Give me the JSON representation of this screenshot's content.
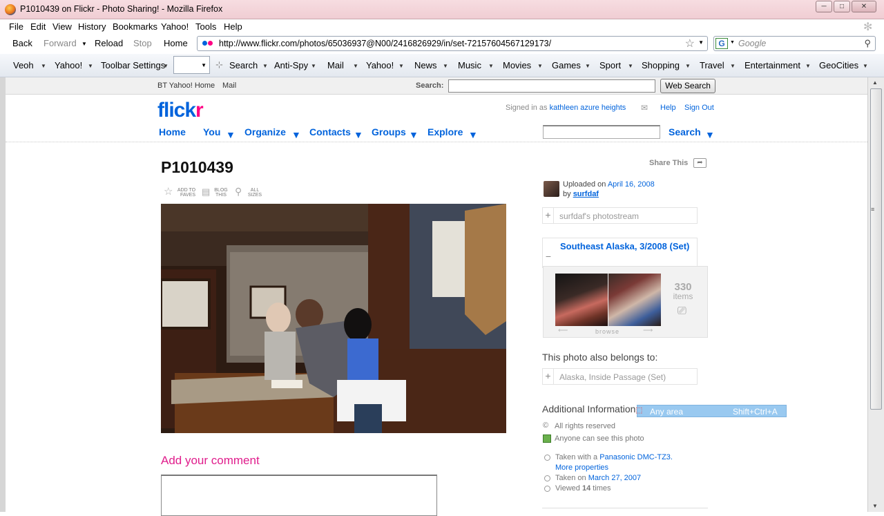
{
  "window": {
    "title": "P1010439 on Flickr - Photo Sharing! - Mozilla Firefox",
    "min": "─",
    "max": "□",
    "close": "✕"
  },
  "menu": [
    "File",
    "Edit",
    "View",
    "History",
    "Bookmarks",
    "Yahoo!",
    "Tools",
    "Help"
  ],
  "nav": {
    "back": "Back",
    "forward": "Forward",
    "reload": "Reload",
    "stop": "Stop",
    "home": "Home",
    "url": "http://www.flickr.com/photos/65036937@N00/2416826929/in/set-72157604567129173/",
    "search_placeholder": "Google"
  },
  "yahoo_toolbar": [
    "Veoh",
    "Yahoo!",
    "Toolbar Settings",
    "Search",
    "Anti-Spy",
    "Mail",
    "Yahoo!",
    "News",
    "Music",
    "Movies",
    "Games",
    "Sport",
    "Shopping",
    "Travel",
    "Entertainment",
    "GeoCities"
  ],
  "bt_bar": {
    "home": "BT Yahoo! Home",
    "mail": "Mail",
    "search_label": "Search:",
    "button": "Web Search"
  },
  "flickr": {
    "logo_a": "flick",
    "logo_b": "r",
    "signed_in_prefix": "Signed in as",
    "user": "kathleen azure heights",
    "help": "Help",
    "signout": "Sign Out",
    "nav": [
      "Home",
      "You",
      "Organize",
      "Contacts",
      "Groups",
      "Explore"
    ],
    "search_button": "Search"
  },
  "photo": {
    "title": "P1010439",
    "share": "Share This",
    "tools": [
      [
        "ADD TO",
        "FAVES"
      ],
      [
        "BLOG",
        "THIS"
      ],
      [
        "ALL",
        "SIZES"
      ]
    ],
    "add_comment": "Add your comment"
  },
  "sidebar": {
    "uploaded_prefix": "Uploaded on",
    "uploaded_date": "April 16, 2008",
    "by_prefix": "by",
    "owner": "surfdaf",
    "photostream": "surfdaf's photostream",
    "set_title": "Southeast Alaska, 3/2008 (Set)",
    "set_count": "330",
    "set_items": "items",
    "browse": "browse",
    "belongs": "This photo also belongs to:",
    "other_set": "Alaska, Inside Passage (Set)",
    "additional": "Additional Information",
    "tooltip_left": "Any area",
    "tooltip_right": "Shift+Ctrl+A",
    "rights": "All rights reserved",
    "visibility": "Anyone can see this photo",
    "taken_with_prefix": "Taken with a",
    "camera": "Panasonic DMC-TZ3.",
    "more_props": "More properties",
    "taken_on_prefix": "Taken on",
    "taken_date": "March 27, 2007",
    "viewed_prefix": "Viewed",
    "viewed_count": "14",
    "viewed_suffix": "times"
  }
}
